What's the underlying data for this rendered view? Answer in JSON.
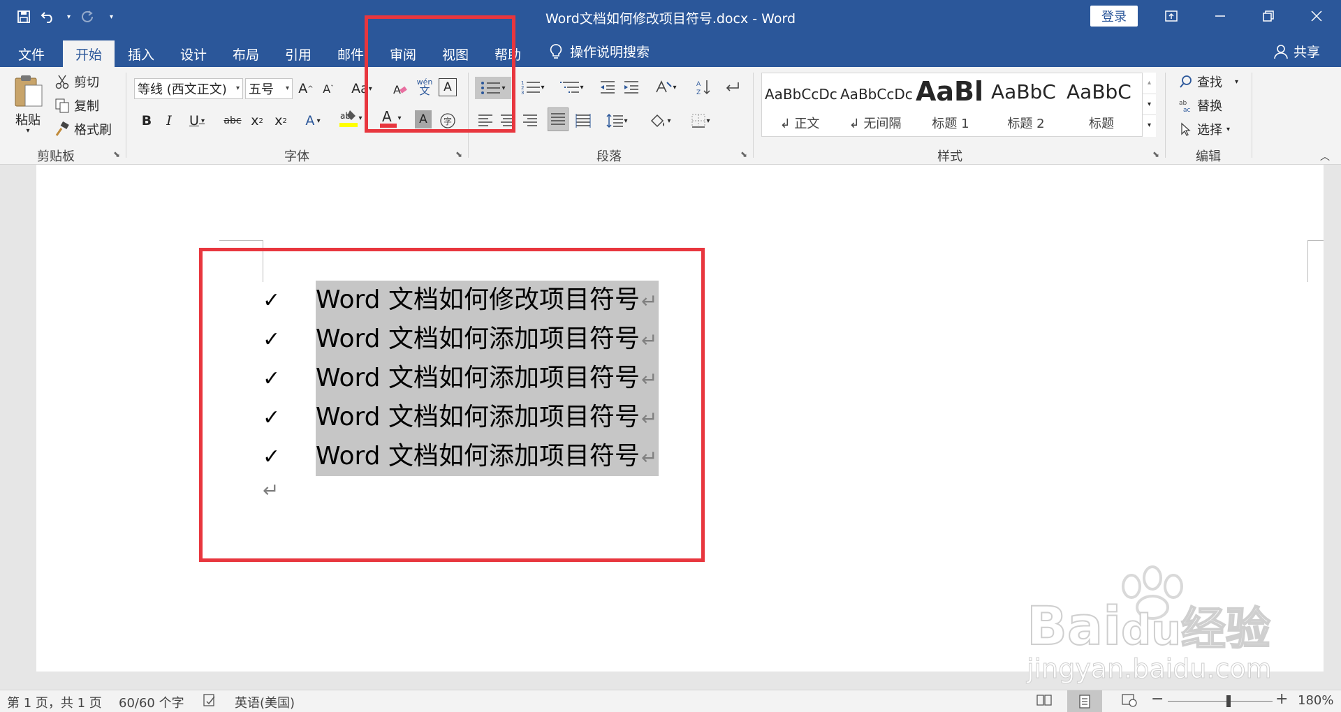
{
  "window": {
    "title": "Word文档如何修改项目符号.docx  -  Word",
    "login_label": "登录"
  },
  "tabs": [
    "文件",
    "开始",
    "插入",
    "设计",
    "布局",
    "引用",
    "邮件",
    "审阅",
    "视图",
    "帮助"
  ],
  "active_tab": "开始",
  "tell_me": "操作说明搜索",
  "share": "共享",
  "ribbon": {
    "clipboard": {
      "paste": "粘贴",
      "cut": "剪切",
      "copy": "复制",
      "format_painter": "格式刷",
      "label": "剪贴板"
    },
    "font": {
      "font_name": "等线 (西文正文)",
      "font_size": "五号",
      "phonetic_top": "wén",
      "phonetic_bottom": "文",
      "label": "字体"
    },
    "paragraph": {
      "label": "段落"
    },
    "styles": {
      "label": "样式",
      "items": [
        {
          "preview": "AaBbCcDc",
          "name": "↲ 正文"
        },
        {
          "preview": "AaBbCcDc",
          "name": "↲ 无间隔"
        },
        {
          "preview": "AaBl",
          "name": "标题 1"
        },
        {
          "preview": "AaBbC",
          "name": "标题 2"
        },
        {
          "preview": "AaBbC",
          "name": "标题"
        }
      ]
    },
    "editing": {
      "find": "查找",
      "replace": "替换",
      "select": "选择",
      "label": "编辑"
    }
  },
  "document": {
    "items": [
      "Word 文档如何修改项目符号",
      "Word 文档如何添加项目符号",
      "Word 文档如何添加项目符号",
      "Word 文档如何添加项目符号",
      "Word 文档如何添加项目符号"
    ],
    "bullet_symbol": "✓",
    "paragraph_mark": "↵"
  },
  "status": {
    "page": "第 1 页，共 1 页",
    "words": "60/60 个字",
    "language": "英语(美国)",
    "zoom": "180%"
  },
  "watermark": {
    "brand": "Bai",
    "brand2": "du",
    "product": "经验",
    "url": "jingyan.baidu.com"
  },
  "colors": {
    "ribbon_blue": "#2b579a",
    "highlight_red": "#e8363e",
    "selection_gray": "#c6c6c6"
  }
}
